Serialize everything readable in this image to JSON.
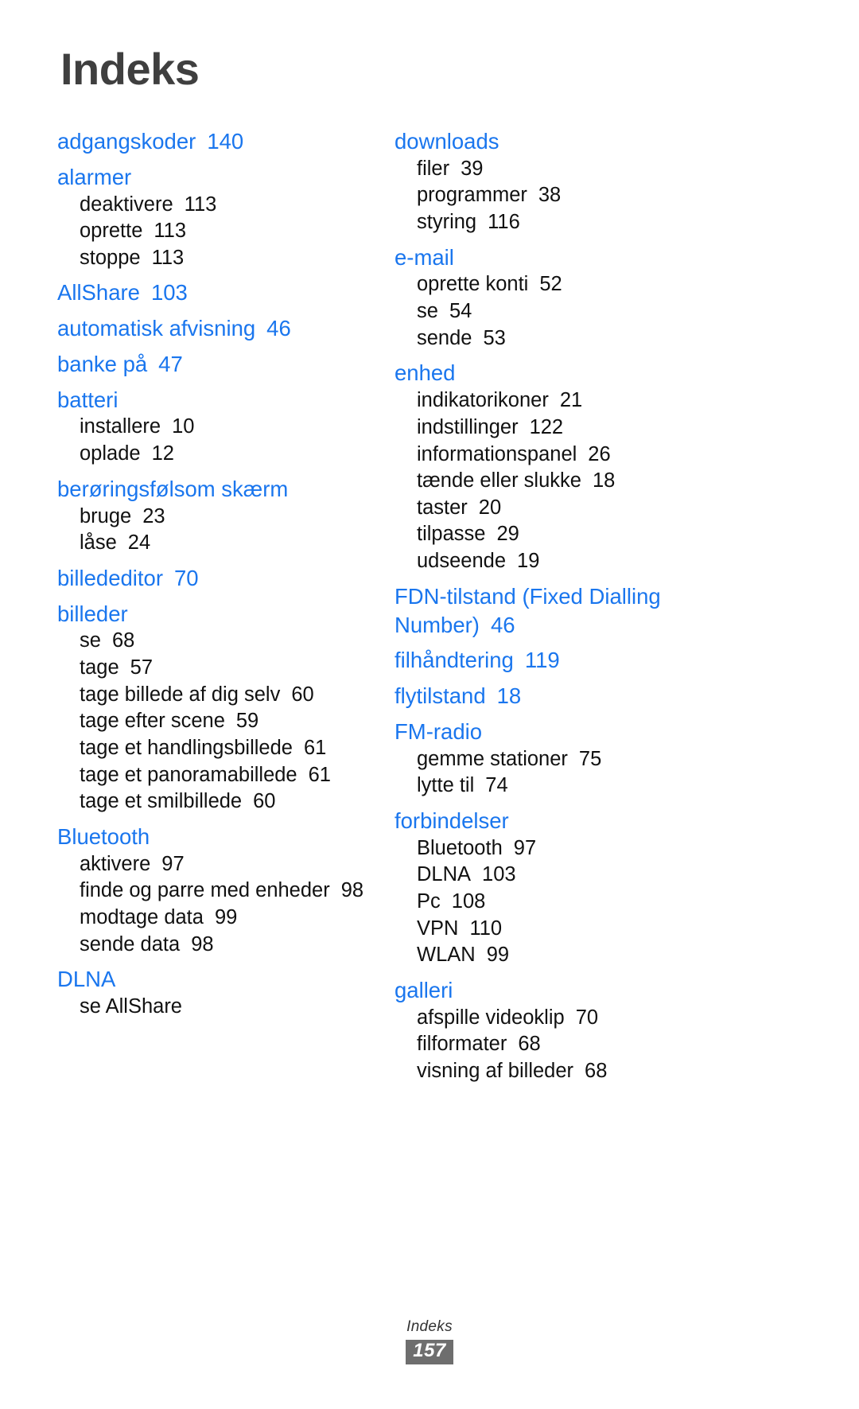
{
  "page": {
    "title": "Indeks",
    "footer_label": "Indeks",
    "page_number": "157",
    "accent_color": "#1a76ee",
    "title_color": "#3f3f3f",
    "badge_bg": "#6e6e6e"
  },
  "columns": [
    {
      "id": "left",
      "entries": [
        {
          "term": "adgangskoder",
          "page": "140",
          "subs": []
        },
        {
          "term": "alarmer",
          "page": "",
          "subs": [
            {
              "label": "deaktivere",
              "page": "113"
            },
            {
              "label": "oprette",
              "page": "113"
            },
            {
              "label": "stoppe",
              "page": "113"
            }
          ]
        },
        {
          "term": "AllShare",
          "page": "103",
          "subs": []
        },
        {
          "term": "automatisk afvisning",
          "page": "46",
          "subs": []
        },
        {
          "term": "banke på",
          "page": "47",
          "subs": []
        },
        {
          "term": "batteri",
          "page": "",
          "subs": [
            {
              "label": "installere",
              "page": "10"
            },
            {
              "label": "oplade",
              "page": "12"
            }
          ]
        },
        {
          "term": "berøringsfølsom skærm",
          "page": "",
          "subs": [
            {
              "label": "bruge",
              "page": "23"
            },
            {
              "label": "låse",
              "page": "24"
            }
          ]
        },
        {
          "term": "billededitor",
          "page": "70",
          "subs": []
        },
        {
          "term": "billeder",
          "page": "",
          "subs": [
            {
              "label": "se",
              "page": "68"
            },
            {
              "label": "tage",
              "page": "57"
            },
            {
              "label": "tage billede af dig selv",
              "page": "60"
            },
            {
              "label": "tage efter scene",
              "page": "59"
            },
            {
              "label": "tage et handlingsbillede",
              "page": "61"
            },
            {
              "label": "tage et panoramabillede",
              "page": "61"
            },
            {
              "label": "tage et smilbillede",
              "page": "60"
            }
          ]
        },
        {
          "term": "Bluetooth",
          "page": "",
          "subs": [
            {
              "label": "aktivere",
              "page": "97"
            },
            {
              "label": "finde og parre med enheder",
              "page": "98"
            },
            {
              "label": "modtage data",
              "page": "99"
            },
            {
              "label": "sende data",
              "page": "98"
            }
          ]
        },
        {
          "term": "DLNA",
          "page": "",
          "subs": [
            {
              "label": "se AllShare",
              "page": ""
            }
          ]
        }
      ]
    },
    {
      "id": "right",
      "entries": [
        {
          "term": "downloads",
          "page": "",
          "subs": [
            {
              "label": "filer",
              "page": "39"
            },
            {
              "label": "programmer",
              "page": "38"
            },
            {
              "label": "styring",
              "page": "116"
            }
          ]
        },
        {
          "term": "e-mail",
          "page": "",
          "subs": [
            {
              "label": "oprette konti",
              "page": "52"
            },
            {
              "label": "se",
              "page": "54"
            },
            {
              "label": "sende",
              "page": "53"
            }
          ]
        },
        {
          "term": "enhed",
          "page": "",
          "subs": [
            {
              "label": "indikatorikoner",
              "page": "21"
            },
            {
              "label": "indstillinger",
              "page": "122"
            },
            {
              "label": "informationspanel",
              "page": "26"
            },
            {
              "label": "tænde eller slukke",
              "page": "18"
            },
            {
              "label": "taster",
              "page": "20"
            },
            {
              "label": "tilpasse",
              "page": "29"
            },
            {
              "label": "udseende",
              "page": "19"
            }
          ]
        },
        {
          "term": "FDN-tilstand (Fixed Dialling Number)",
          "page": "46",
          "subs": []
        },
        {
          "term": "filhåndtering",
          "page": "119",
          "subs": []
        },
        {
          "term": "flytilstand",
          "page": "18",
          "subs": []
        },
        {
          "term": "FM-radio",
          "page": "",
          "subs": [
            {
              "label": "gemme stationer",
              "page": "75"
            },
            {
              "label": "lytte til",
              "page": "74"
            }
          ]
        },
        {
          "term": "forbindelser",
          "page": "",
          "subs": [
            {
              "label": "Bluetooth",
              "page": "97"
            },
            {
              "label": "DLNA",
              "page": "103"
            },
            {
              "label": "Pc",
              "page": "108"
            },
            {
              "label": "VPN",
              "page": "110"
            },
            {
              "label": "WLAN",
              "page": "99"
            }
          ]
        },
        {
          "term": "galleri",
          "page": "",
          "subs": [
            {
              "label": "afspille videoklip",
              "page": "70"
            },
            {
              "label": "filformater",
              "page": "68"
            },
            {
              "label": "visning af billeder",
              "page": "68"
            }
          ]
        }
      ]
    }
  ]
}
